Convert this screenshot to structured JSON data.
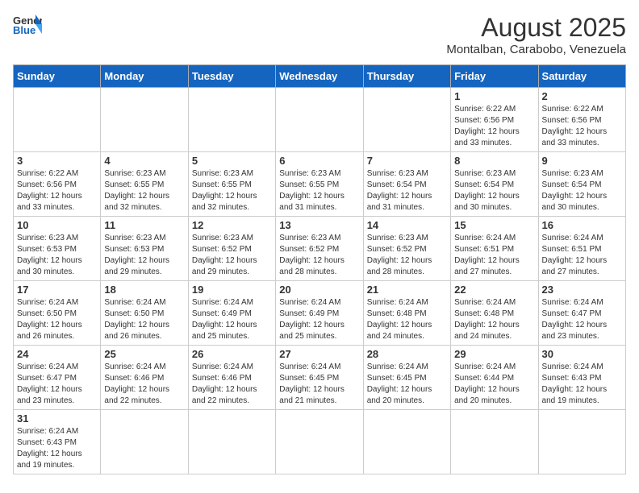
{
  "header": {
    "logo_general": "General",
    "logo_blue": "Blue",
    "month_year": "August 2025",
    "location": "Montalban, Carabobo, Venezuela"
  },
  "weekdays": [
    "Sunday",
    "Monday",
    "Tuesday",
    "Wednesday",
    "Thursday",
    "Friday",
    "Saturday"
  ],
  "weeks": [
    [
      {
        "day": "",
        "info": ""
      },
      {
        "day": "",
        "info": ""
      },
      {
        "day": "",
        "info": ""
      },
      {
        "day": "",
        "info": ""
      },
      {
        "day": "",
        "info": ""
      },
      {
        "day": "1",
        "info": "Sunrise: 6:22 AM\nSunset: 6:56 PM\nDaylight: 12 hours\nand 33 minutes."
      },
      {
        "day": "2",
        "info": "Sunrise: 6:22 AM\nSunset: 6:56 PM\nDaylight: 12 hours\nand 33 minutes."
      }
    ],
    [
      {
        "day": "3",
        "info": "Sunrise: 6:22 AM\nSunset: 6:56 PM\nDaylight: 12 hours\nand 33 minutes."
      },
      {
        "day": "4",
        "info": "Sunrise: 6:23 AM\nSunset: 6:55 PM\nDaylight: 12 hours\nand 32 minutes."
      },
      {
        "day": "5",
        "info": "Sunrise: 6:23 AM\nSunset: 6:55 PM\nDaylight: 12 hours\nand 32 minutes."
      },
      {
        "day": "6",
        "info": "Sunrise: 6:23 AM\nSunset: 6:55 PM\nDaylight: 12 hours\nand 31 minutes."
      },
      {
        "day": "7",
        "info": "Sunrise: 6:23 AM\nSunset: 6:54 PM\nDaylight: 12 hours\nand 31 minutes."
      },
      {
        "day": "8",
        "info": "Sunrise: 6:23 AM\nSunset: 6:54 PM\nDaylight: 12 hours\nand 30 minutes."
      },
      {
        "day": "9",
        "info": "Sunrise: 6:23 AM\nSunset: 6:54 PM\nDaylight: 12 hours\nand 30 minutes."
      }
    ],
    [
      {
        "day": "10",
        "info": "Sunrise: 6:23 AM\nSunset: 6:53 PM\nDaylight: 12 hours\nand 30 minutes."
      },
      {
        "day": "11",
        "info": "Sunrise: 6:23 AM\nSunset: 6:53 PM\nDaylight: 12 hours\nand 29 minutes."
      },
      {
        "day": "12",
        "info": "Sunrise: 6:23 AM\nSunset: 6:52 PM\nDaylight: 12 hours\nand 29 minutes."
      },
      {
        "day": "13",
        "info": "Sunrise: 6:23 AM\nSunset: 6:52 PM\nDaylight: 12 hours\nand 28 minutes."
      },
      {
        "day": "14",
        "info": "Sunrise: 6:23 AM\nSunset: 6:52 PM\nDaylight: 12 hours\nand 28 minutes."
      },
      {
        "day": "15",
        "info": "Sunrise: 6:24 AM\nSunset: 6:51 PM\nDaylight: 12 hours\nand 27 minutes."
      },
      {
        "day": "16",
        "info": "Sunrise: 6:24 AM\nSunset: 6:51 PM\nDaylight: 12 hours\nand 27 minutes."
      }
    ],
    [
      {
        "day": "17",
        "info": "Sunrise: 6:24 AM\nSunset: 6:50 PM\nDaylight: 12 hours\nand 26 minutes."
      },
      {
        "day": "18",
        "info": "Sunrise: 6:24 AM\nSunset: 6:50 PM\nDaylight: 12 hours\nand 26 minutes."
      },
      {
        "day": "19",
        "info": "Sunrise: 6:24 AM\nSunset: 6:49 PM\nDaylight: 12 hours\nand 25 minutes."
      },
      {
        "day": "20",
        "info": "Sunrise: 6:24 AM\nSunset: 6:49 PM\nDaylight: 12 hours\nand 25 minutes."
      },
      {
        "day": "21",
        "info": "Sunrise: 6:24 AM\nSunset: 6:48 PM\nDaylight: 12 hours\nand 24 minutes."
      },
      {
        "day": "22",
        "info": "Sunrise: 6:24 AM\nSunset: 6:48 PM\nDaylight: 12 hours\nand 24 minutes."
      },
      {
        "day": "23",
        "info": "Sunrise: 6:24 AM\nSunset: 6:47 PM\nDaylight: 12 hours\nand 23 minutes."
      }
    ],
    [
      {
        "day": "24",
        "info": "Sunrise: 6:24 AM\nSunset: 6:47 PM\nDaylight: 12 hours\nand 23 minutes."
      },
      {
        "day": "25",
        "info": "Sunrise: 6:24 AM\nSunset: 6:46 PM\nDaylight: 12 hours\nand 22 minutes."
      },
      {
        "day": "26",
        "info": "Sunrise: 6:24 AM\nSunset: 6:46 PM\nDaylight: 12 hours\nand 22 minutes."
      },
      {
        "day": "27",
        "info": "Sunrise: 6:24 AM\nSunset: 6:45 PM\nDaylight: 12 hours\nand 21 minutes."
      },
      {
        "day": "28",
        "info": "Sunrise: 6:24 AM\nSunset: 6:45 PM\nDaylight: 12 hours\nand 20 minutes."
      },
      {
        "day": "29",
        "info": "Sunrise: 6:24 AM\nSunset: 6:44 PM\nDaylight: 12 hours\nand 20 minutes."
      },
      {
        "day": "30",
        "info": "Sunrise: 6:24 AM\nSunset: 6:43 PM\nDaylight: 12 hours\nand 19 minutes."
      }
    ],
    [
      {
        "day": "31",
        "info": "Sunrise: 6:24 AM\nSunset: 6:43 PM\nDaylight: 12 hours\nand 19 minutes."
      },
      {
        "day": "",
        "info": ""
      },
      {
        "day": "",
        "info": ""
      },
      {
        "day": "",
        "info": ""
      },
      {
        "day": "",
        "info": ""
      },
      {
        "day": "",
        "info": ""
      },
      {
        "day": "",
        "info": ""
      }
    ]
  ]
}
